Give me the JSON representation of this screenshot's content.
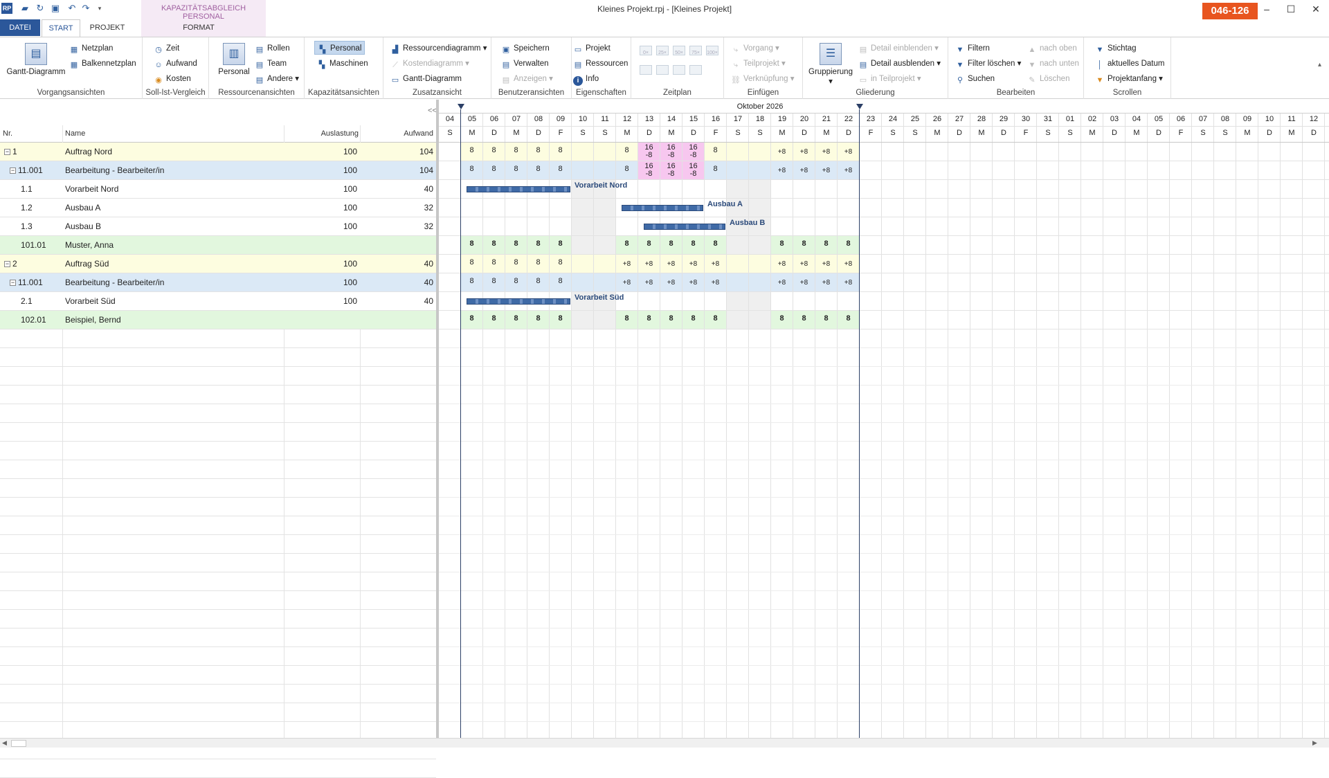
{
  "window": {
    "title": "Kleines Projekt.rpj - [Kleines Projekt]",
    "badge": "046-126",
    "context_tab_label": "KAPAZITÄTSABGLEICH PERSONAL"
  },
  "tabs": [
    "DATEI",
    "START",
    "PROJEKT",
    "FORMAT"
  ],
  "ribbon": {
    "vorgangsansichten": {
      "label": "Vorgangsansichten",
      "gantt": "Gantt-Diagramm",
      "netzplan": "Netzplan",
      "balkennetzplan": "Balkennetzplan"
    },
    "sollist": {
      "label": "Soll-Ist-Vergleich",
      "zeit": "Zeit",
      "aufwand": "Aufwand",
      "kosten": "Kosten"
    },
    "ressourcen": {
      "label": "Ressourcenansichten",
      "personal": "Personal",
      "rollen": "Rollen",
      "team": "Team",
      "andere": "Andere"
    },
    "kapazitaet": {
      "label": "Kapazitätsansichten",
      "personal": "Personal",
      "maschinen": "Maschinen"
    },
    "zusatz": {
      "label": "Zusatzansicht",
      "ressourcendiagramm": "Ressourcendiagramm",
      "kostendiagramm": "Kostendiagramm",
      "gantt": "Gantt-Diagramm"
    },
    "benutzer": {
      "label": "Benutzeransichten",
      "speichern": "Speichern",
      "verwalten": "Verwalten",
      "anzeigen": "Anzeigen"
    },
    "eigenschaften": {
      "label": "Eigenschaften",
      "projekt": "Projekt",
      "ressourcen": "Ressourcen",
      "info": "Info"
    },
    "zeitplan": {
      "label": "Zeitplan",
      "zoom": [
        "0×",
        "25×",
        "50×",
        "75×",
        "100×"
      ]
    },
    "einfuegen": {
      "label": "Einfügen",
      "vorgang": "Vorgang",
      "teilprojekt": "Teilprojekt",
      "verknuepfung": "Verknüpfung"
    },
    "gliederung": {
      "label": "Gliederung",
      "gruppierung": "Gruppierung",
      "detail_ein": "Detail einblenden",
      "detail_aus": "Detail ausblenden",
      "in_teilprojekt": "in Teilprojekt"
    },
    "bearbeiten": {
      "label": "Bearbeiten",
      "filtern": "Filtern",
      "filter_loeschen": "Filter löschen",
      "suchen": "Suchen",
      "nach_oben": "nach oben",
      "nach_unten": "nach unten",
      "loeschen": "Löschen"
    },
    "scrollen": {
      "label": "Scrollen",
      "stichtag": "Stichtag",
      "aktuelles_datum": "aktuelles Datum",
      "projektanfang": "Projektanfang"
    }
  },
  "grid": {
    "collapse_label": "<<",
    "columns": [
      "Nr.",
      "Name",
      "Auslastung",
      "Aufwand"
    ],
    "rows": [
      {
        "nr": "1",
        "name": "Auftrag Nord",
        "auslastung": "100",
        "aufwand": "104",
        "kind": "order",
        "exp": "−",
        "indent": 0
      },
      {
        "nr": "11.001",
        "name": "Bearbeitung - Bearbeiter/in",
        "auslastung": "100",
        "aufwand": "104",
        "kind": "role",
        "exp": "−",
        "indent": 1
      },
      {
        "nr": "1.1",
        "name": "Vorarbeit Nord",
        "auslastung": "100",
        "aufwand": "40",
        "kind": "task",
        "exp": "",
        "indent": 2
      },
      {
        "nr": "1.2",
        "name": "Ausbau A",
        "auslastung": "100",
        "aufwand": "32",
        "kind": "task",
        "exp": "",
        "indent": 2
      },
      {
        "nr": "1.3",
        "name": "Ausbau B",
        "auslastung": "100",
        "aufwand": "32",
        "kind": "task",
        "exp": "",
        "indent": 2
      },
      {
        "nr": "101.01",
        "name": "Muster, Anna",
        "auslastung": "",
        "aufwand": "",
        "kind": "person",
        "exp": "",
        "indent": 2
      },
      {
        "nr": "2",
        "name": "Auftrag Süd",
        "auslastung": "100",
        "aufwand": "40",
        "kind": "order",
        "exp": "−",
        "indent": 0
      },
      {
        "nr": "11.001",
        "name": "Bearbeitung - Bearbeiter/in",
        "auslastung": "100",
        "aufwand": "40",
        "kind": "role",
        "exp": "−",
        "indent": 1
      },
      {
        "nr": "2.1",
        "name": "Vorarbeit Süd",
        "auslastung": "100",
        "aufwand": "40",
        "kind": "task",
        "exp": "",
        "indent": 2
      },
      {
        "nr": "102.01",
        "name": "Beispiel, Bernd",
        "auslastung": "",
        "aufwand": "",
        "kind": "person",
        "exp": "",
        "indent": 2
      }
    ]
  },
  "gantt": {
    "month": "Oktober 2026",
    "days": [
      {
        "n": "04",
        "w": "S"
      },
      {
        "n": "05",
        "w": "M"
      },
      {
        "n": "06",
        "w": "D"
      },
      {
        "n": "07",
        "w": "M"
      },
      {
        "n": "08",
        "w": "D"
      },
      {
        "n": "09",
        "w": "F"
      },
      {
        "n": "10",
        "w": "S"
      },
      {
        "n": "11",
        "w": "S"
      },
      {
        "n": "12",
        "w": "M"
      },
      {
        "n": "13",
        "w": "D"
      },
      {
        "n": "14",
        "w": "M"
      },
      {
        "n": "15",
        "w": "D"
      },
      {
        "n": "16",
        "w": "F"
      },
      {
        "n": "17",
        "w": "S"
      },
      {
        "n": "18",
        "w": "S"
      },
      {
        "n": "19",
        "w": "M"
      },
      {
        "n": "20",
        "w": "D"
      },
      {
        "n": "21",
        "w": "M"
      },
      {
        "n": "22",
        "w": "D"
      },
      {
        "n": "23",
        "w": "F"
      },
      {
        "n": "24",
        "w": "S"
      },
      {
        "n": "25",
        "w": "S"
      },
      {
        "n": "26",
        "w": "M"
      },
      {
        "n": "27",
        "w": "D"
      },
      {
        "n": "28",
        "w": "M"
      },
      {
        "n": "29",
        "w": "D"
      },
      {
        "n": "30",
        "w": "F"
      },
      {
        "n": "31",
        "w": "S"
      },
      {
        "n": "01",
        "w": "S"
      },
      {
        "n": "02",
        "w": "M"
      },
      {
        "n": "03",
        "w": "D"
      },
      {
        "n": "04",
        "w": "M"
      },
      {
        "n": "05",
        "w": "D"
      },
      {
        "n": "06",
        "w": "F"
      },
      {
        "n": "07",
        "w": "S"
      },
      {
        "n": "08",
        "w": "S"
      },
      {
        "n": "09",
        "w": "M"
      },
      {
        "n": "10",
        "w": "D"
      },
      {
        "n": "11",
        "w": "M"
      },
      {
        "n": "12",
        "w": "D"
      }
    ],
    "weekend_indices": [
      6,
      7,
      13,
      14
    ],
    "row_bg": {
      "order": "#fdfde0",
      "role": "#dbe9f6",
      "person": "#e2f7de",
      "over": "#f7c7ef"
    },
    "values": [
      {
        "row": 0,
        "cells": [
          [
            "8",
            ""
          ],
          [
            "8",
            ""
          ],
          [
            "8",
            ""
          ],
          [
            "8",
            ""
          ],
          [
            "8",
            ""
          ],
          [
            "",
            ""
          ],
          [
            "",
            ""
          ],
          [
            "8",
            ""
          ],
          [
            "16",
            "-8"
          ],
          [
            "16",
            "-8"
          ],
          [
            "16",
            "-8"
          ],
          [
            "8",
            ""
          ],
          [
            "",
            ""
          ],
          [
            "",
            ""
          ],
          [
            "+8",
            ""
          ],
          [
            "+8",
            ""
          ],
          [
            "+8",
            ""
          ],
          [
            "+8",
            ""
          ]
        ],
        "start": 1
      },
      {
        "row": 1,
        "cells": [
          [
            "8",
            ""
          ],
          [
            "8",
            ""
          ],
          [
            "8",
            ""
          ],
          [
            "8",
            ""
          ],
          [
            "8",
            ""
          ],
          [
            "",
            ""
          ],
          [
            "",
            ""
          ],
          [
            "8",
            ""
          ],
          [
            "16",
            "-8"
          ],
          [
            "16",
            "-8"
          ],
          [
            "16",
            "-8"
          ],
          [
            "8",
            ""
          ],
          [
            "",
            ""
          ],
          [
            "",
            ""
          ],
          [
            "+8",
            ""
          ],
          [
            "+8",
            ""
          ],
          [
            "+8",
            ""
          ],
          [
            "+8",
            ""
          ]
        ],
        "start": 1
      },
      {
        "row": 5,
        "cells": [
          [
            "8",
            ""
          ],
          [
            "8",
            ""
          ],
          [
            "8",
            ""
          ],
          [
            "8",
            ""
          ],
          [
            "8",
            ""
          ],
          [
            "",
            ""
          ],
          [
            "",
            ""
          ],
          [
            "8",
            ""
          ],
          [
            "8",
            ""
          ],
          [
            "8",
            ""
          ],
          [
            "8",
            ""
          ],
          [
            "8",
            ""
          ],
          [
            "",
            ""
          ],
          [
            "",
            ""
          ],
          [
            "8",
            ""
          ],
          [
            "8",
            ""
          ],
          [
            "8",
            ""
          ],
          [
            "8",
            ""
          ]
        ],
        "start": 1,
        "bold": true
      },
      {
        "row": 6,
        "cells": [
          [
            "8",
            ""
          ],
          [
            "8",
            ""
          ],
          [
            "8",
            ""
          ],
          [
            "8",
            ""
          ],
          [
            "8",
            ""
          ],
          [
            "",
            ""
          ],
          [
            "",
            ""
          ],
          [
            "+8",
            ""
          ],
          [
            "+8",
            ""
          ],
          [
            "+8",
            ""
          ],
          [
            "+8",
            ""
          ],
          [
            "+8",
            ""
          ],
          [
            "",
            ""
          ],
          [
            "",
            ""
          ],
          [
            "+8",
            ""
          ],
          [
            "+8",
            ""
          ],
          [
            "+8",
            ""
          ],
          [
            "+8",
            ""
          ]
        ],
        "start": 1
      },
      {
        "row": 7,
        "cells": [
          [
            "8",
            ""
          ],
          [
            "8",
            ""
          ],
          [
            "8",
            ""
          ],
          [
            "8",
            ""
          ],
          [
            "8",
            ""
          ],
          [
            "",
            ""
          ],
          [
            "",
            ""
          ],
          [
            "+8",
            ""
          ],
          [
            "+8",
            ""
          ],
          [
            "+8",
            ""
          ],
          [
            "+8",
            ""
          ],
          [
            "+8",
            ""
          ],
          [
            "",
            ""
          ],
          [
            "",
            ""
          ],
          [
            "+8",
            ""
          ],
          [
            "+8",
            ""
          ],
          [
            "+8",
            ""
          ],
          [
            "+8",
            ""
          ]
        ],
        "start": 1
      },
      {
        "row": 9,
        "cells": [
          [
            "8",
            ""
          ],
          [
            "8",
            ""
          ],
          [
            "8",
            ""
          ],
          [
            "8",
            ""
          ],
          [
            "8",
            ""
          ],
          [
            "",
            ""
          ],
          [
            "",
            ""
          ],
          [
            "8",
            ""
          ],
          [
            "8",
            ""
          ],
          [
            "8",
            ""
          ],
          [
            "8",
            ""
          ],
          [
            "8",
            ""
          ],
          [
            "",
            ""
          ],
          [
            "",
            ""
          ],
          [
            "8",
            ""
          ],
          [
            "8",
            ""
          ],
          [
            "8",
            ""
          ],
          [
            "8",
            ""
          ]
        ],
        "start": 1,
        "bold": true
      }
    ],
    "overloaded": [
      {
        "row": 0,
        "days": [
          9,
          10,
          11
        ]
      },
      {
        "row": 1,
        "days": [
          9,
          10,
          11
        ]
      }
    ],
    "bars": [
      {
        "row": 2,
        "start": 1,
        "end": 5,
        "label": "Vorarbeit Nord"
      },
      {
        "row": 3,
        "start": 8,
        "end": 11,
        "label": "Ausbau A"
      },
      {
        "row": 4,
        "start": 9,
        "end": 12,
        "label": "Ausbau B"
      },
      {
        "row": 8,
        "start": 1,
        "end": 5,
        "label": "Vorarbeit Süd"
      }
    ],
    "range_start_day": 1,
    "range_end_day": 18
  },
  "colors": {
    "accent": "#2b579a",
    "bar": "#3f6aa6",
    "badge": "#e8551f"
  }
}
